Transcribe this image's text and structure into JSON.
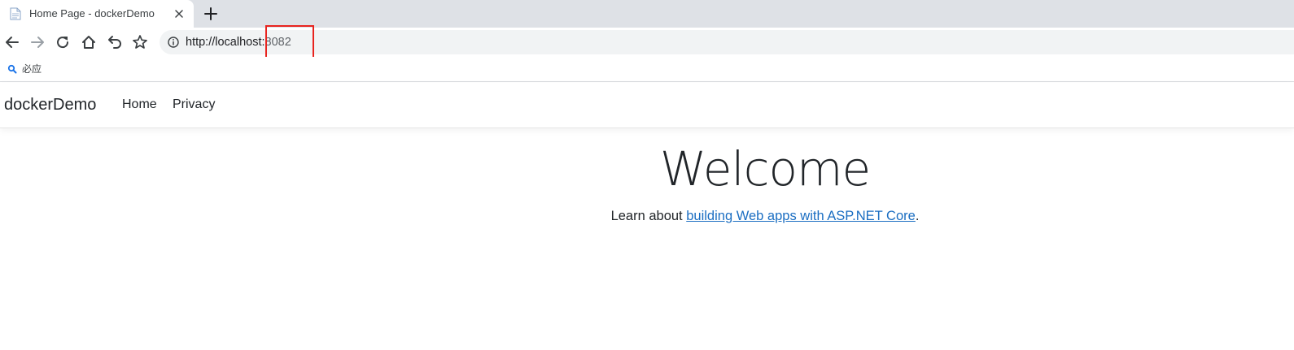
{
  "browser": {
    "tab": {
      "title": "Home Page - dockerDemo",
      "favicon": "page-icon"
    },
    "toolbar": {
      "buttons": [
        "back-icon",
        "forward-icon",
        "reload-icon",
        "home-icon",
        "undo-icon",
        "star-icon"
      ],
      "url_host": "http://localhost:",
      "url_port": "8082"
    },
    "bookmarks": [
      {
        "label": "必应",
        "icon": "search-icon"
      }
    ],
    "highlight_color": "#e8231e"
  },
  "site": {
    "brand": "dockerDemo",
    "nav": [
      "Home",
      "Privacy"
    ],
    "heading": "Welcome",
    "lead_prefix": "Learn about ",
    "lead_link": "building Web apps with ASP.NET Core",
    "lead_suffix": ".",
    "link_color": "#1b6ec2"
  }
}
